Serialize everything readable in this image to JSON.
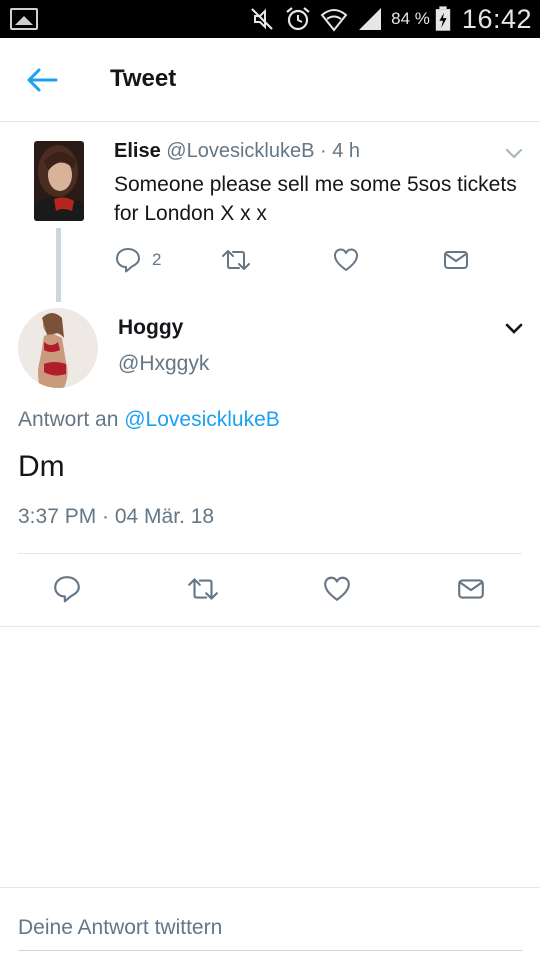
{
  "status_bar": {
    "battery_percent": "84 %",
    "time": "16:42",
    "icons": [
      "gallery-icon",
      "mute-icon",
      "alarm-icon",
      "wifi-icon",
      "signal-icon",
      "battery-icon"
    ]
  },
  "header": {
    "title": "Tweet",
    "back_icon": "arrow-left-icon"
  },
  "parent_tweet": {
    "name": "Elise",
    "handle": "@LovesicklukeB",
    "separator": "·",
    "time": "4 h",
    "text": "Someone please sell me some 5sos tickets for London X x x",
    "reply_count": "2",
    "actions": [
      "reply-icon",
      "retweet-icon",
      "like-icon",
      "message-icon"
    ]
  },
  "main_tweet": {
    "name": "Hoggy",
    "handle": "@Hxggyk",
    "reply_prefix": "Antwort an ",
    "reply_to": "@LovesicklukeB",
    "text": "Dm",
    "timestamp": "3:37 PM · 04 Mär. 18",
    "actions": [
      "reply-icon",
      "retweet-icon",
      "like-icon",
      "message-icon"
    ]
  },
  "composer": {
    "placeholder": "Deine Antwort twittern"
  },
  "colors": {
    "accent": "#1da1f2",
    "text_primary": "#14171a",
    "text_secondary": "#657786",
    "divider": "#e1e8ed",
    "icon": "#657786"
  }
}
